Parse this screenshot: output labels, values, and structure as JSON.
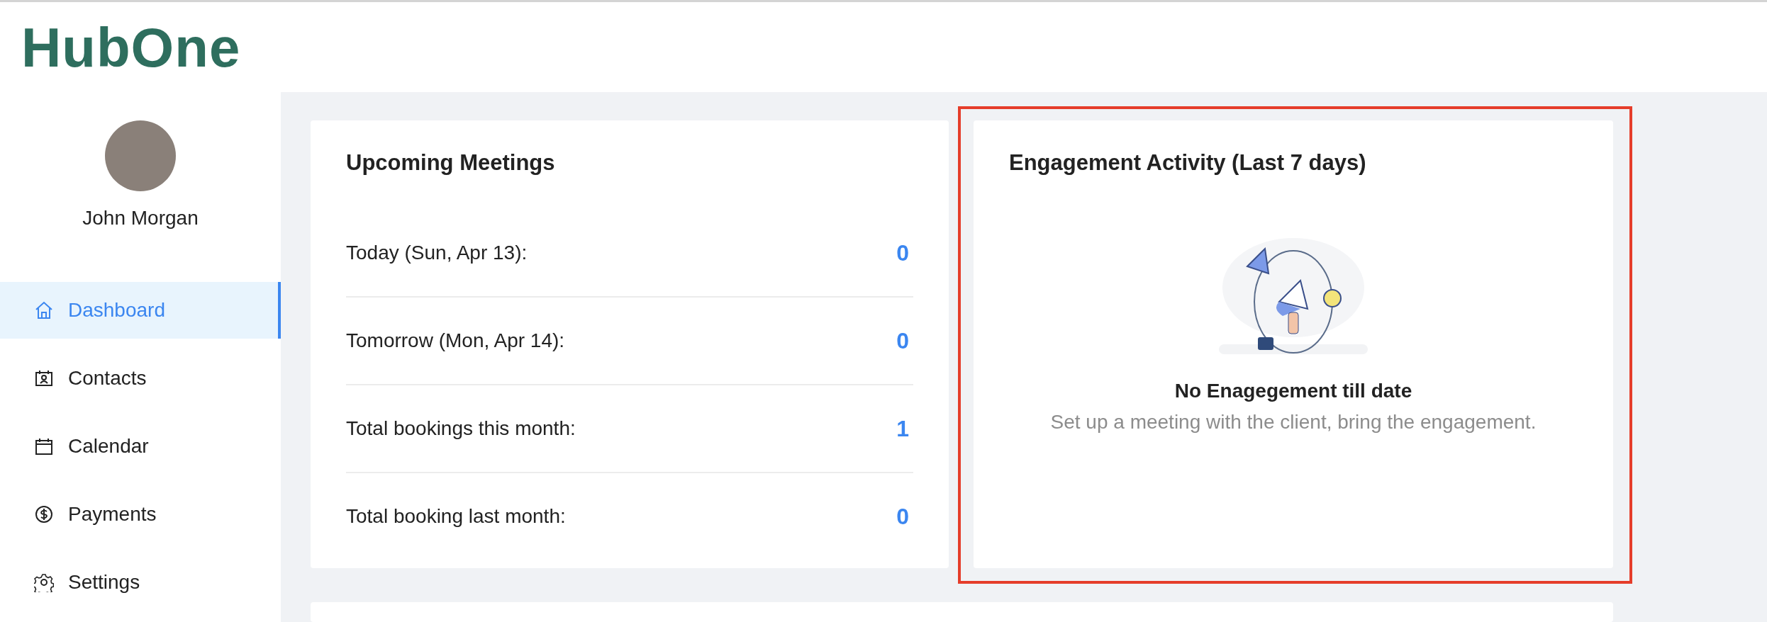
{
  "logo": {
    "text": "HubOne"
  },
  "user": {
    "name": "John Morgan"
  },
  "sidebar": {
    "items": [
      {
        "label": "Dashboard",
        "selected": true
      },
      {
        "label": "Contacts",
        "selected": false
      },
      {
        "label": "Calendar",
        "selected": false
      },
      {
        "label": "Payments",
        "selected": false
      },
      {
        "label": "Settings",
        "selected": false
      }
    ]
  },
  "upcoming_meetings": {
    "title": "Upcoming Meetings",
    "rows": [
      {
        "label": "Today (Sun, Apr 13):",
        "value": "0"
      },
      {
        "label": "Tomorrow (Mon, Apr 14):",
        "value": "0"
      },
      {
        "label": "Total bookings this month:",
        "value": "1"
      },
      {
        "label": "Total booking last month:",
        "value": "0"
      }
    ]
  },
  "engagement_activity": {
    "title": "Engagement Activity (Last 7 days)",
    "highlighted": true,
    "empty_title": "No Enagegement till date",
    "empty_text": "Set up a meeting with the client, bring the engagement."
  }
}
